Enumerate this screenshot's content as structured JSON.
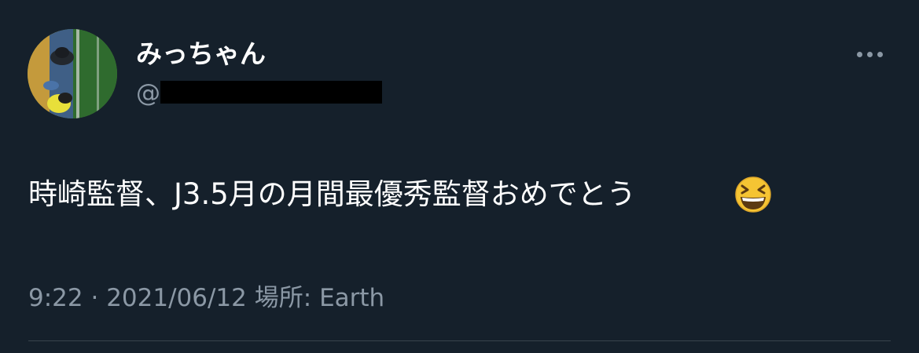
{
  "tweet": {
    "display_name": "みっちゃん",
    "handle_prefix": "@",
    "handle_visible_fragment": "",
    "text": "時崎監督、J3.5月の月間最優秀監督おめでとう",
    "emoji_name": "grinning-squinting-face",
    "time": "9:22",
    "separator": "·",
    "date": "2021/06/12",
    "location_label": "場所:",
    "location": "Earth"
  },
  "icons": {
    "more": "more-horizontal-icon"
  },
  "colors": {
    "background": "#15202b",
    "primary_text": "#ffffff",
    "secondary_text": "#8b98a5",
    "divider": "#38444d",
    "redaction": "#000000"
  }
}
